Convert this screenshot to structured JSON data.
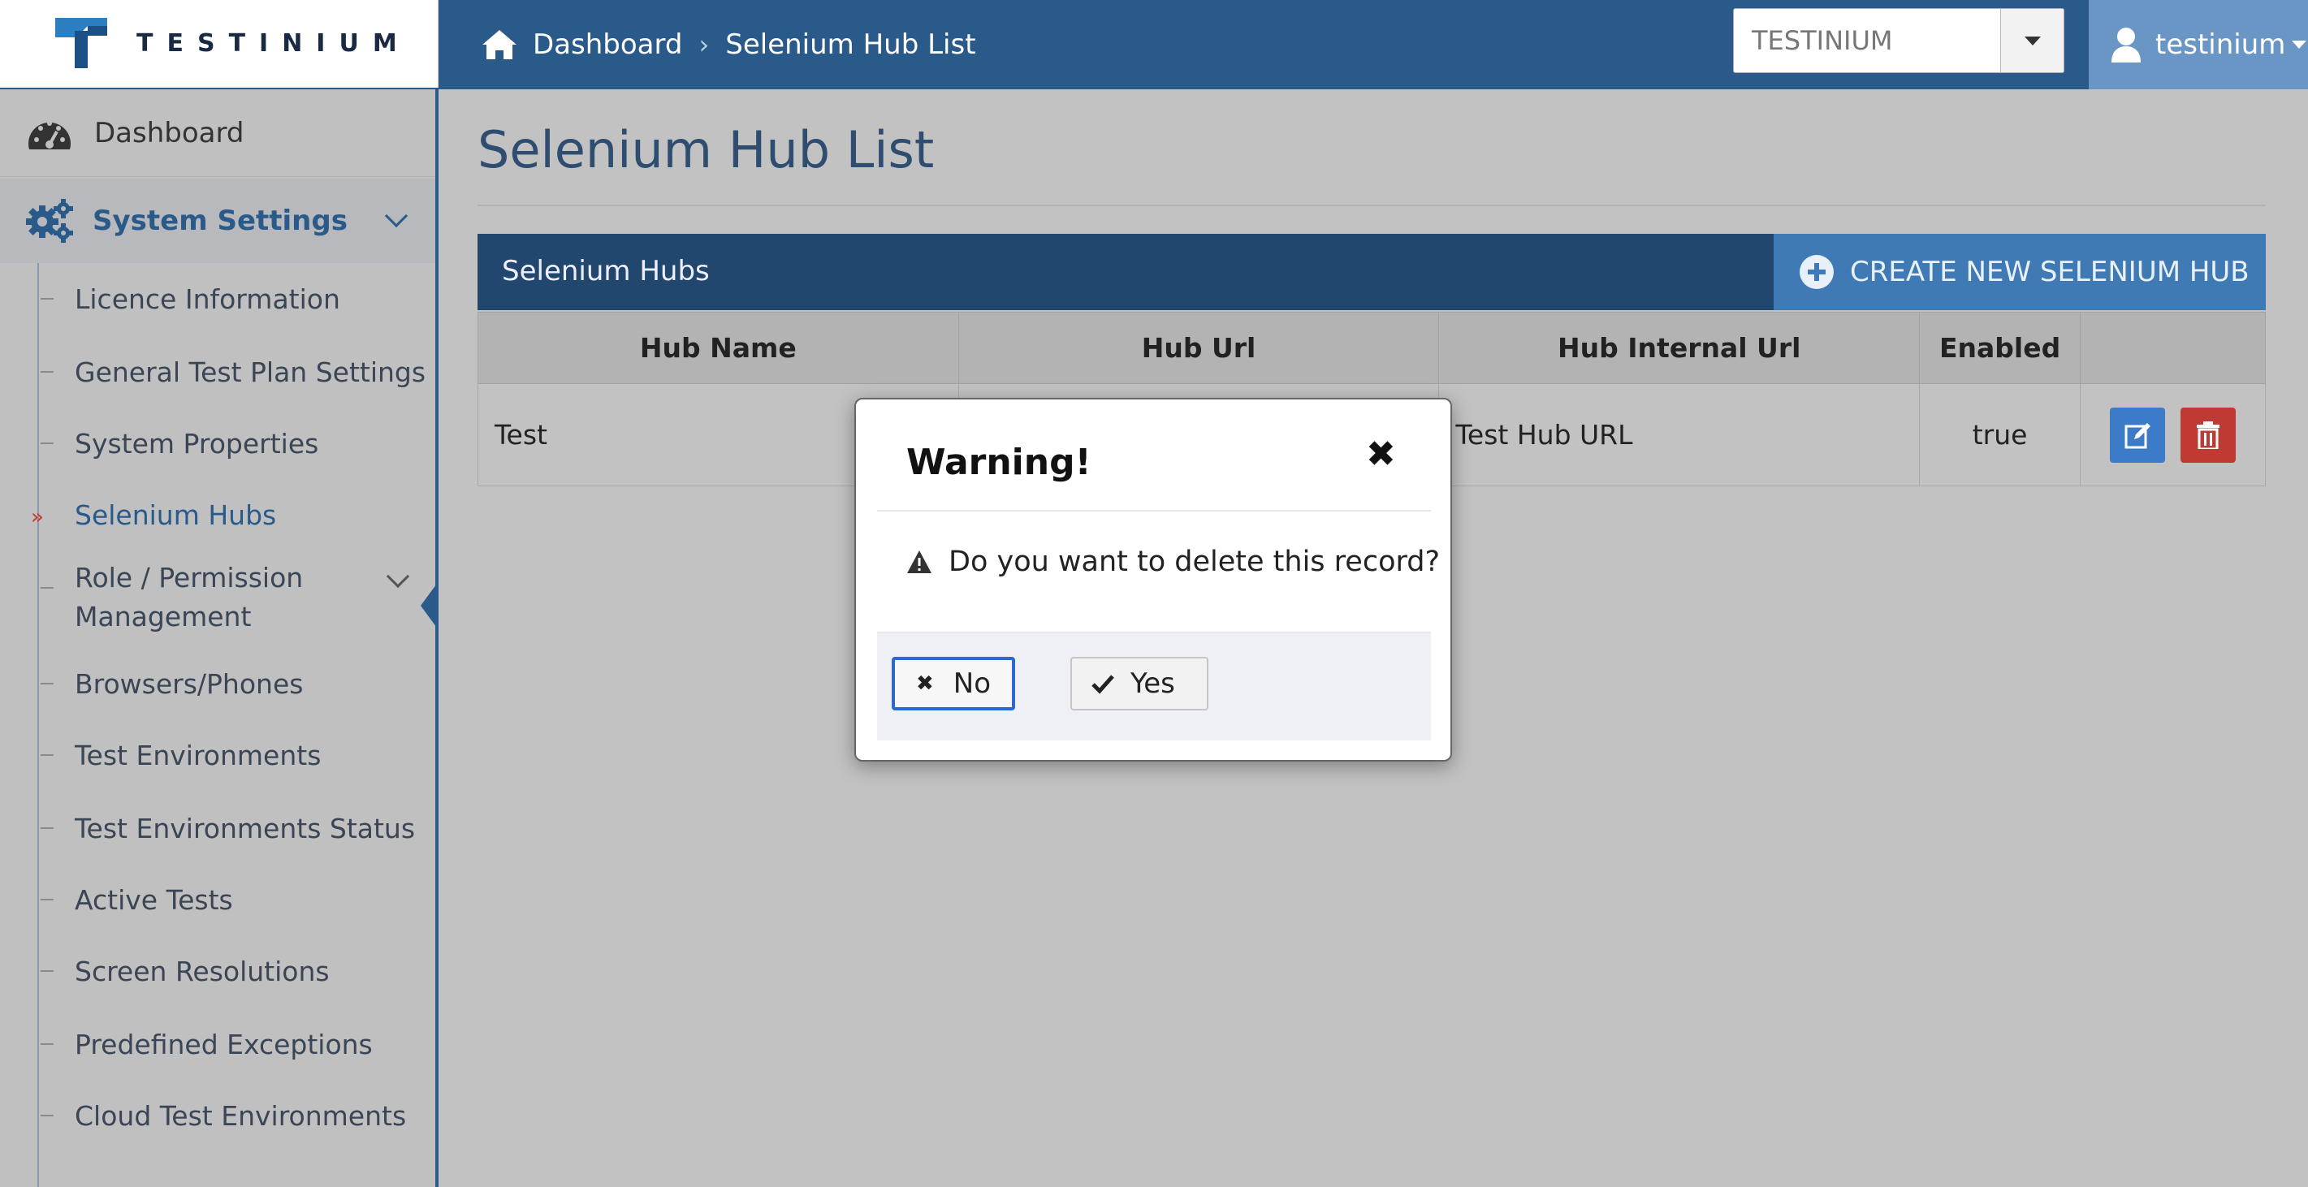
{
  "header": {
    "logo_text": "TESTINIUM",
    "breadcrumb": {
      "home": "Dashboard",
      "current": "Selenium Hub List"
    },
    "company_select": {
      "value": "TESTINIUM"
    },
    "user": {
      "name": "testinium"
    }
  },
  "sidebar": {
    "dashboard": "Dashboard",
    "system_settings": "System Settings",
    "items": [
      {
        "label": "Licence Information"
      },
      {
        "label": "General Test Plan Settings"
      },
      {
        "label": "System Properties"
      },
      {
        "label": "Selenium Hubs",
        "active": true
      },
      {
        "label": "Role / Permission Management"
      },
      {
        "label": "Browsers/Phones"
      },
      {
        "label": "Test Environments"
      },
      {
        "label": "Test Environments Status"
      },
      {
        "label": "Active Tests"
      },
      {
        "label": "Screen Resolutions"
      },
      {
        "label": "Predefined Exceptions"
      },
      {
        "label": "Cloud Test Environments"
      }
    ]
  },
  "main": {
    "title": "Selenium Hub List",
    "panel_title": "Selenium Hubs",
    "create_button": "CREATE NEW SELENIUM HUB",
    "table": {
      "columns": [
        "Hub Name",
        "Hub Url",
        "Hub Internal Url",
        "Enabled",
        ""
      ],
      "rows": [
        {
          "hub_name": "Test",
          "hub_url": "",
          "hub_internal_url": "Test Hub URL",
          "enabled": "true"
        }
      ]
    }
  },
  "modal": {
    "title": "Warning!",
    "message": "Do you want to delete this record?",
    "no_label": "No",
    "yes_label": "Yes"
  },
  "colors": {
    "brand_dark": "#2a5a8a",
    "panel_header": "#22476f",
    "create_button": "#3f7ab4",
    "edit_button": "#3b7bc8",
    "delete_button": "#c03a34"
  }
}
